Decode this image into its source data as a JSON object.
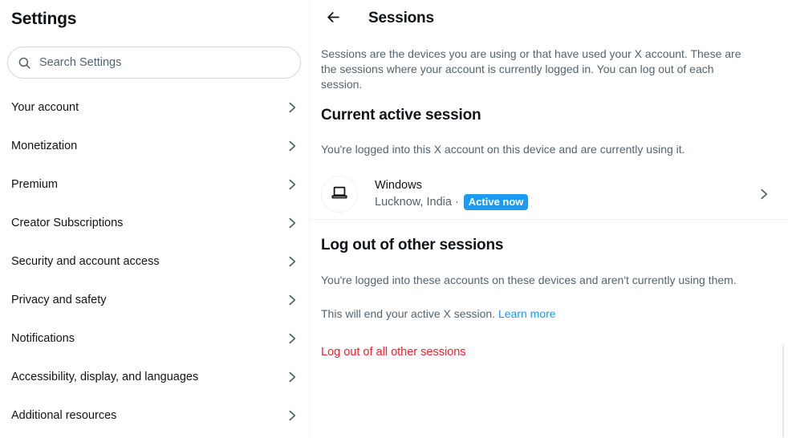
{
  "sidebar": {
    "title": "Settings",
    "search": {
      "placeholder": "Search Settings",
      "value": "",
      "icon": "search-icon"
    },
    "items": [
      {
        "label": "Your account",
        "icon": "chevron-right-icon"
      },
      {
        "label": "Monetization",
        "icon": "chevron-right-icon"
      },
      {
        "label": "Premium",
        "icon": "chevron-right-icon"
      },
      {
        "label": "Creator Subscriptions",
        "icon": "chevron-right-icon"
      },
      {
        "label": "Security and account access",
        "icon": "chevron-right-icon"
      },
      {
        "label": "Privacy and safety",
        "icon": "chevron-right-icon"
      },
      {
        "label": "Notifications",
        "icon": "chevron-right-icon"
      },
      {
        "label": "Accessibility, display, and languages",
        "icon": "chevron-right-icon"
      },
      {
        "label": "Additional resources",
        "icon": "chevron-right-icon"
      }
    ]
  },
  "main": {
    "back_icon": "back-arrow-icon",
    "title": "Sessions",
    "intro": "Sessions are the devices you are using or that have used your X account. These are the sessions where your account is currently logged in. You can log out of each session.",
    "current_session": {
      "heading": "Current active session",
      "description": "You're logged into this X account on this device and are currently using it.",
      "device": {
        "icon": "laptop-icon",
        "name": "Windows",
        "location": "Lucknow, India ·",
        "status_badge": "Active now",
        "chevron_icon": "chevron-right-icon"
      }
    },
    "other_sessions": {
      "heading": "Log out of other sessions",
      "description": "You're logged into these accounts on these devices and aren't currently using them.",
      "end_note_text": "This will end your active X session.",
      "learn_more": "Learn more",
      "logout_all_label": "Log out of all other sessions"
    }
  },
  "annotation": {
    "type": "red-arrow",
    "color": "#f40000",
    "points_to": "Current active session"
  },
  "colors": {
    "accent_blue": "#1d9bf0",
    "danger_red": "#f4212e",
    "text_primary": "#0f1419",
    "text_secondary": "#536471",
    "border": "#eff3f4",
    "annotation_red": "#f40000"
  }
}
